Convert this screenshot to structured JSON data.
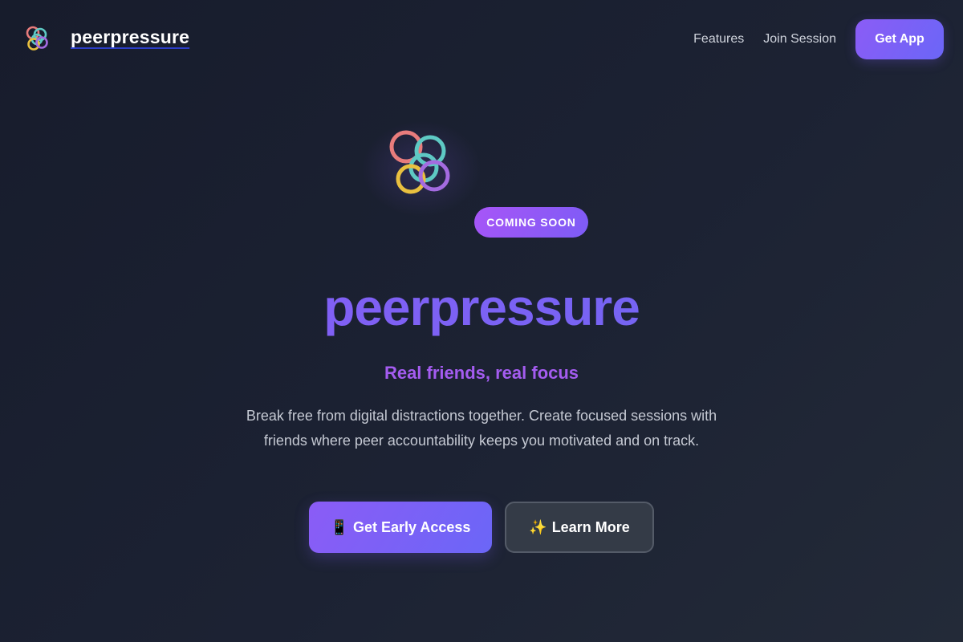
{
  "nav": {
    "brand_name": "peerpressure",
    "links": [
      "Features",
      "Join Session"
    ],
    "cta_label": "Get App"
  },
  "hero": {
    "badge": "COMING SOON",
    "title": "peerpressure",
    "tagline": "Real friends, real focus",
    "description": "Break free from digital distractions together. Create focused sessions with friends where peer accountability keeps you motivated and on track.",
    "primary_button": {
      "icon": "📱",
      "label": "Get Early Access"
    },
    "secondary_button": {
      "icon": "✨",
      "label": "Learn More"
    }
  },
  "logo_rings": [
    {
      "color": "#e87c7c"
    },
    {
      "color": "#5ec9c4"
    },
    {
      "color": "#5ec9c4"
    },
    {
      "color": "#e9c03f"
    },
    {
      "color": "#a46be0"
    }
  ],
  "colors": {
    "accent": "#8b5cf6",
    "accent_secondary": "#6b66f7",
    "tagline": "#a45cf0",
    "background": "#1c2233"
  }
}
